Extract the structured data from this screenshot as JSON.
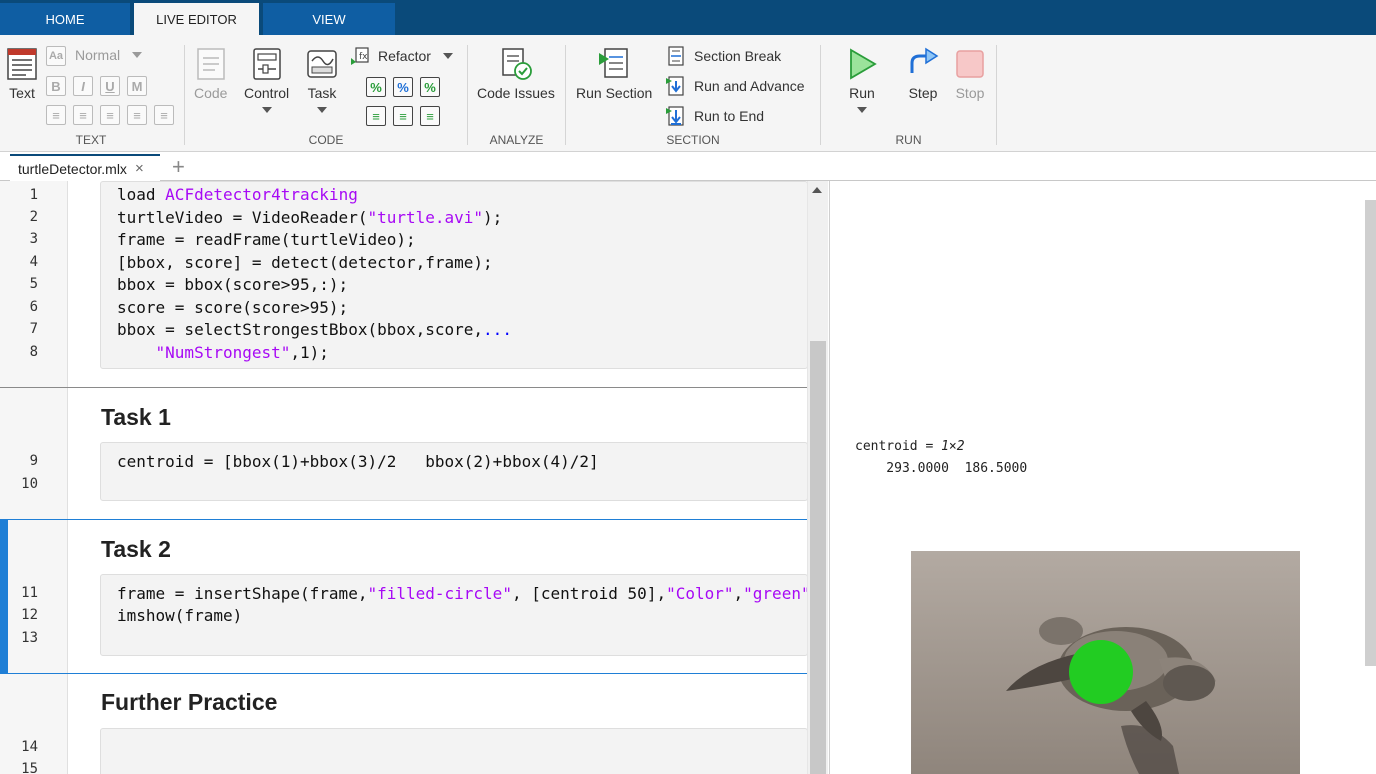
{
  "tabs": [
    {
      "label": "HOME"
    },
    {
      "label": "LIVE EDITOR"
    },
    {
      "label": "VIEW"
    }
  ],
  "ribbon": {
    "text_group": {
      "label": "TEXT",
      "text_button": "Text",
      "style_value": "Normal",
      "bold": "B",
      "italic": "I",
      "underline": "U",
      "monospace": "M"
    },
    "code_group": {
      "label": "CODE",
      "code_button": "Code",
      "control_button": "Control",
      "task_button": "Task",
      "refactor_button": "Refactor"
    },
    "analyze_group": {
      "label": "ANALYZE",
      "code_issues_button": "Code Issues"
    },
    "section_group": {
      "label": "SECTION",
      "run_section_button": "Run Section",
      "section_break_button": "Section Break",
      "run_and_advance_button": "Run and Advance",
      "run_to_end_button": "Run to End"
    },
    "run_group": {
      "label": "RUN",
      "run_button": "Run",
      "step_button": "Step",
      "stop_button": "Stop"
    }
  },
  "document_tab": {
    "filename": "turtleDetector.mlx",
    "close_symbol": "×",
    "add_symbol": "+"
  },
  "line_numbers": [
    "1",
    "2",
    "3",
    "4",
    "5",
    "6",
    "7",
    "8",
    "9",
    "10",
    "11",
    "12",
    "13",
    "14",
    "15"
  ],
  "code_lines": {
    "l1_a": "load ",
    "l1_b": "ACFdetector4tracking",
    "l2_a": "turtleVideo = VideoReader(",
    "l2_b": "\"turtle.avi\"",
    "l2_c": ");",
    "l3": "frame = readFrame(turtleVideo);",
    "l4": "[bbox, score] = detect(detector,frame);",
    "l5": "bbox = bbox(score>95,:);",
    "l6": "score = score(score>95);",
    "l7_a": "bbox = selectStrongestBbox(bbox,score,",
    "l7_b": "...",
    "l8_a": "    ",
    "l8_b": "\"NumStrongest\"",
    "l8_c": ",1);",
    "l9": "centroid = [bbox(1)+bbox(3)/2   bbox(2)+bbox(4)/2]",
    "l11_a": "frame = insertShape(frame,",
    "l11_b": "\"filled-circle\"",
    "l11_c": ", [centroid 50],",
    "l11_d": "\"Color\"",
    "l11_e": ",",
    "l11_f": "\"green\"",
    "l12": "imshow(frame)"
  },
  "sections": [
    {
      "heading": "Task 1"
    },
    {
      "heading": "Task 2"
    },
    {
      "heading": "Further Practice"
    }
  ],
  "output": {
    "var_line_a": "centroid = ",
    "var_line_b": "1×2",
    "values": "    293.0000  186.5000"
  },
  "colors": {
    "tabbar": "#0a4a7a",
    "string": "#a709f5",
    "keyword": "#0000ff",
    "active_section": "#1f7fd6",
    "marker": "#22cc22"
  }
}
